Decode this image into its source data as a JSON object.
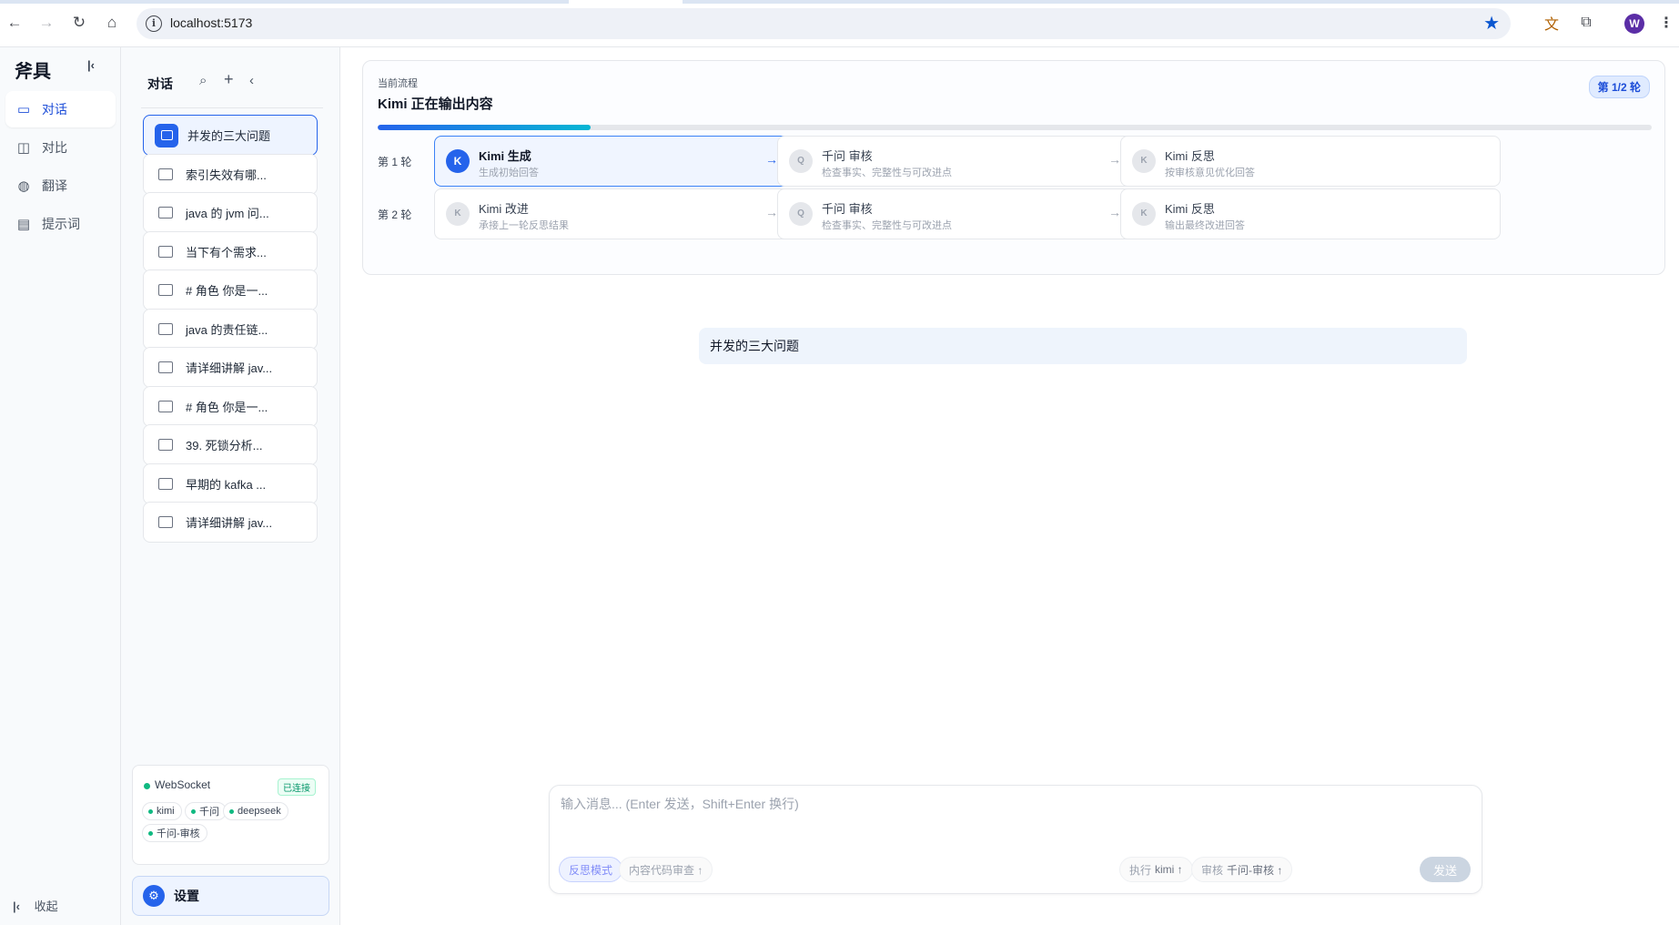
{
  "browser": {
    "url": "localhost:5173",
    "profile_initial": "W"
  },
  "appnav": {
    "brand": "斧具",
    "items": [
      {
        "label": "对话",
        "icon": "chat-icon"
      },
      {
        "label": "对比",
        "icon": "columns-icon"
      },
      {
        "label": "翻译",
        "icon": "globe-icon"
      },
      {
        "label": "提示词",
        "icon": "document-icon"
      }
    ],
    "collapse_label": "收起"
  },
  "convlist": {
    "title": "对话",
    "items": [
      "并发的三大问题",
      "索引失效有哪...",
      "java 的 jvm 问...",
      "当下有个需求...",
      "# 角色 你是一...",
      "java 的责任链...",
      "请详细讲解 jav...",
      "# 角色 你是一...",
      "39. 死锁分析...",
      "早期的 kafka ...",
      "请详细讲解 jav..."
    ],
    "ws": {
      "label": "WebSocket",
      "status": "已连接",
      "models": [
        "kimi",
        "千问",
        "deepseek",
        "千问-审核"
      ]
    },
    "settings_label": "设置"
  },
  "flow": {
    "subtitle": "当前流程",
    "title": "Kimi 正在输出内容",
    "round_badge": "第 1/2 轮",
    "progress": 0.167,
    "rounds": [
      {
        "label": "第 1 轮",
        "steps": [
          {
            "avatar": "K",
            "title": "Kimi 生成",
            "desc": "生成初始回答",
            "active": true
          },
          {
            "avatar": "Q",
            "title": "千问 审核",
            "desc": "检查事实、完整性与可改进点",
            "active": false
          },
          {
            "avatar": "K",
            "title": "Kimi 反思",
            "desc": "按审核意见优化回答",
            "active": false
          }
        ]
      },
      {
        "label": "第 2 轮",
        "steps": [
          {
            "avatar": "K",
            "title": "Kimi 改进",
            "desc": "承接上一轮反思结果",
            "active": false
          },
          {
            "avatar": "Q",
            "title": "千问 审核",
            "desc": "检查事实、完整性与可改进点",
            "active": false
          },
          {
            "avatar": "K",
            "title": "Kimi 反思",
            "desc": "输出最终改进回答",
            "active": false
          }
        ]
      }
    ]
  },
  "chat": {
    "user_message": "并发的三大问题"
  },
  "composer": {
    "placeholder": "输入消息... (Enter 发送，Shift+Enter 换行)",
    "reflect_mode": "反思模式",
    "code_review": "内容代码审查 ↑",
    "exec_label": "执行",
    "exec_value": "kimi ↑",
    "review_label": "审核",
    "review_value": "千问-审核 ↑",
    "send": "发送"
  }
}
